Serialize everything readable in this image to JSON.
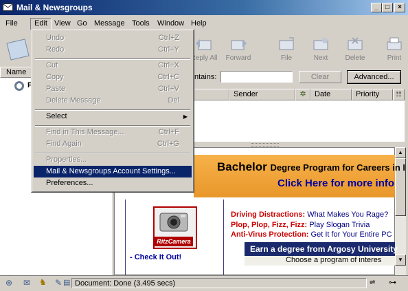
{
  "window": {
    "title": "Mail & Newsgroups"
  },
  "menubar": {
    "items": [
      "File",
      "Edit",
      "View",
      "Go",
      "Message",
      "Tools",
      "Window",
      "Help"
    ]
  },
  "toolbar": {
    "items": [
      "Reply All",
      "Forward",
      "File",
      "Next",
      "Delete",
      "Print"
    ]
  },
  "left_pane": {
    "column_header": "Name",
    "first_item_initial": "F"
  },
  "search": {
    "label": "ntains:",
    "value": "",
    "clear_label": "Clear",
    "advanced_label": "Advanced..."
  },
  "thread_columns": [
    "Sender",
    "Date",
    "Priority"
  ],
  "edit_menu": {
    "items": [
      {
        "label": "Undo",
        "shortcut": "Ctrl+Z",
        "enabled": false
      },
      {
        "label": "Redo",
        "shortcut": "Ctrl+Y",
        "enabled": false
      },
      {
        "label": "Cut",
        "shortcut": "Ctrl+X",
        "enabled": false
      },
      {
        "label": "Copy",
        "shortcut": "Ctrl+C",
        "enabled": false
      },
      {
        "label": "Paste",
        "shortcut": "Ctrl+V",
        "enabled": false
      },
      {
        "label": "Delete Message",
        "shortcut": "Del",
        "enabled": false
      },
      {
        "label": "Select",
        "shortcut": "",
        "enabled": true
      },
      {
        "label": "Find in This Message...",
        "shortcut": "Ctrl+F",
        "enabled": false
      },
      {
        "label": "Find Again",
        "shortcut": "Ctrl+G",
        "enabled": false
      },
      {
        "label": "Properties...",
        "shortcut": "",
        "enabled": false
      },
      {
        "label": "Mail & Newsgroups Account Settings...",
        "shortcut": "",
        "enabled": true,
        "highlighted": true
      },
      {
        "label": "Preferences...",
        "shortcut": "",
        "enabled": true
      }
    ]
  },
  "ad": {
    "banner_line1": "Bachelor",
    "banner_line1b": "Degree Program for Careers in I",
    "banner_line2": "Click Here for more info",
    "camera_brand": "RitzCamera",
    "check_it_out": "- Check It Out!",
    "lines": [
      {
        "bold": "Driving Distractions:",
        "text": "What Makes You Rage?"
      },
      {
        "bold": "Plop, Plop, Fizz, Fizz:",
        "text": "Play Slogan Trivia"
      },
      {
        "bold": "Anti-Virus Protection:",
        "text": "Get It for Your Entire PC"
      }
    ],
    "argosy_line1": "Earn a degree from Argosy University",
    "argosy_line2": "Choose a program of interes"
  },
  "status": {
    "text": "Document: Done (3.495 secs)"
  },
  "colors": {
    "title_start": "#0a246a",
    "menu_highlight": "#0a246a",
    "chrome": "#d4d0c8"
  }
}
